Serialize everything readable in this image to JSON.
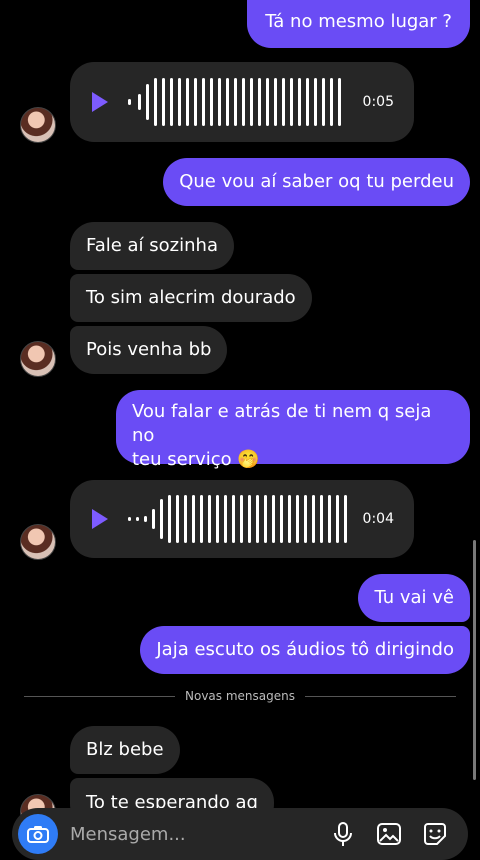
{
  "messages": {
    "out_1": "Tá no mesmo lugar ?",
    "voice_1_duration": "0:05",
    "out_2": "Que vou aí saber oq tu perdeu",
    "in_1": "Fale aí sozinha",
    "in_2": "To sim alecrim dourado",
    "in_3": "Pois venha bb",
    "out_3_line1": "Vou falar e atrás de ti nem q seja no",
    "out_3_line2": "teu serviço 🤭",
    "voice_2_duration": "0:04",
    "out_4": "Tu vai vê",
    "out_5": "Jaja escuto os áudios tô dirigindo",
    "divider": "Novas mensagens",
    "in_4": "Blz bebe",
    "in_5": "To te esperando aq"
  },
  "composer": {
    "placeholder": "Mensagem..."
  },
  "icons": {
    "camera": "camera-icon",
    "mic": "microphone-icon",
    "gallery": "gallery-icon",
    "sticker": "sticker-icon",
    "play": "play-icon"
  },
  "colors": {
    "outgoing": "#6a4cf5",
    "incoming": "#262626",
    "accent": "#2f7cf6"
  }
}
